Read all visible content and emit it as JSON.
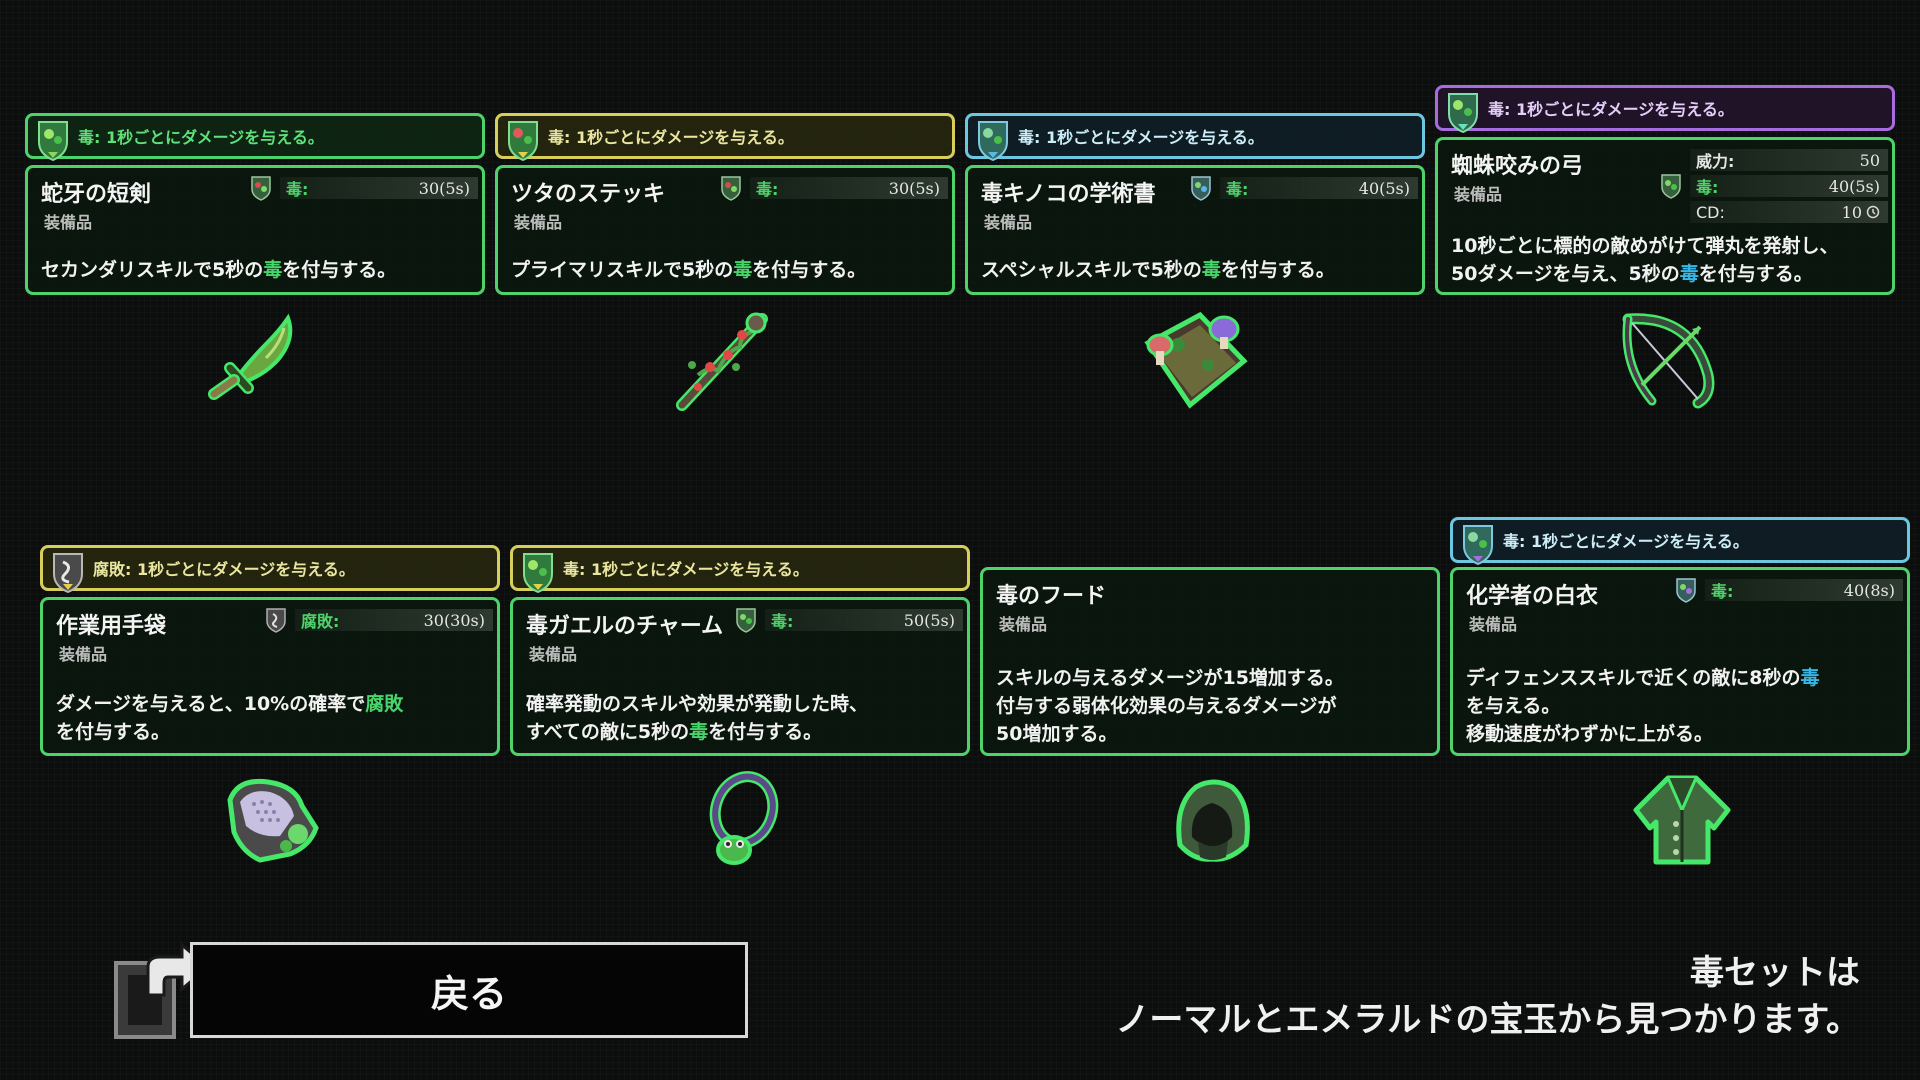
{
  "items": [
    {
      "banner": "毒: 1秒ごとにダメージを与える。",
      "name": "蛇牙の短剣",
      "type": "装備品",
      "stats": [
        {
          "label": "毒:",
          "value": "30(5s)"
        }
      ],
      "desc": {
        "pre": "セカンダリスキルで5秒の",
        "hl": "毒",
        "post": "を付与する。"
      },
      "icon": "dagger-icon"
    },
    {
      "banner": "毒: 1秒ごとにダメージを与える。",
      "name": "ツタのステッキ",
      "type": "装備品",
      "stats": [
        {
          "label": "毒:",
          "value": "30(5s)"
        }
      ],
      "desc": {
        "pre": "プライマリスキルで5秒の",
        "hl": "毒",
        "post": "を付与する。"
      },
      "icon": "vine-staff-icon"
    },
    {
      "banner": "毒: 1秒ごとにダメージを与える。",
      "name": "毒キノコの学術書",
      "type": "装備品",
      "stats": [
        {
          "label": "毒:",
          "value": "40(5s)"
        }
      ],
      "desc": {
        "pre": "スペシャルスキルで5秒の",
        "hl": "毒",
        "post": "を付与する。"
      },
      "icon": "mushroom-book-icon"
    },
    {
      "banner": "毒: 1秒ごとにダメージを与える。",
      "name": "蜘蛛咬みの弓",
      "type": "装備品",
      "stats": [
        {
          "label": "威力:",
          "value": "50"
        },
        {
          "label": "毒:",
          "value": "40(5s)"
        },
        {
          "label": "CD:",
          "value": "10"
        }
      ],
      "desc": {
        "line1": "10秒ごとに標的の敵めがけて弾丸を発射し、",
        "pre": "50ダメージを与え、5秒の",
        "hl": "毒",
        "post": "を付与する。"
      },
      "icon": "bow-icon"
    },
    {
      "banner": "腐敗: 1秒ごとにダメージを与える。",
      "name": "作業用手袋",
      "type": "装備品",
      "stats": [
        {
          "label": "腐敗:",
          "value": "30(30s)"
        }
      ],
      "desc": {
        "pre": "ダメージを与えると、10%の確率で",
        "hl": "腐敗",
        "line2": "を付与する。"
      },
      "icon": "glove-icon"
    },
    {
      "banner": "毒: 1秒ごとにダメージを与える。",
      "name": "毒ガエルのチャーム",
      "type": "装備品",
      "stats": [
        {
          "label": "毒:",
          "value": "50(5s)"
        }
      ],
      "desc": {
        "line1": "確率発動のスキルや効果が発動した時、",
        "pre": "すべての敵に5秒の",
        "hl": "毒",
        "post": "を付与する。"
      },
      "icon": "frog-charm-icon"
    },
    {
      "name": "毒のフード",
      "type": "装備品",
      "desc": {
        "line1": "スキルの与えるダメージが15増加する。",
        "line2": "付与する弱体化効果の与えるダメージが",
        "line3": "50増加する。"
      },
      "icon": "hood-icon"
    },
    {
      "banner": "毒: 1秒ごとにダメージを与える。",
      "name": "化学者の白衣",
      "type": "装備品",
      "stats": [
        {
          "label": "毒:",
          "value": "40(8s)"
        }
      ],
      "desc": {
        "pre": "ディフェンススキルで近くの敵に8秒の",
        "hl": "毒",
        "line2": "を与える。",
        "line3": "移動速度がわずかに上がる。"
      },
      "icon": "coat-icon"
    }
  ],
  "back_button": "戻る",
  "info": {
    "line1": "毒セットは",
    "line2": "ノーマルとエメラルドの宝玉から見つかります。"
  },
  "colors": {
    "card_border": "#4ed36a",
    "banner_green": "#4ed36a",
    "banner_yellow": "#d8cf5a",
    "banner_blue": "#6cc8e0",
    "banner_purple": "#a86be0",
    "highlight": "#48d46a"
  }
}
